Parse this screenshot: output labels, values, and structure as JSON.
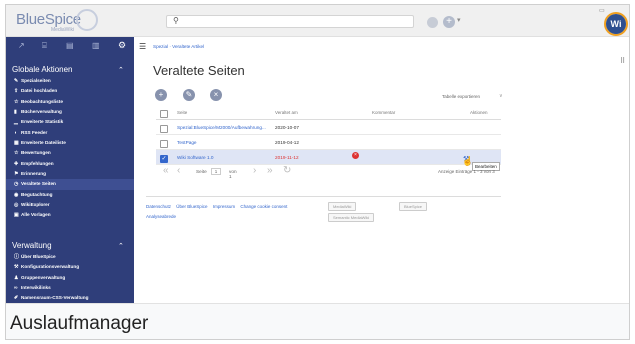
{
  "logo": {
    "text": "BlueSpice",
    "subtitle": "MediaWiki"
  },
  "search": {
    "placeholder": ""
  },
  "user": {
    "initials": "Wi"
  },
  "sidebar": {
    "global_heading": "Globale Aktionen",
    "global_items": [
      {
        "label": "Spezialseiten",
        "icon": "wand-icon"
      },
      {
        "label": "Datei hochladen",
        "icon": "upload-icon"
      },
      {
        "label": "Beobachtungsliste",
        "icon": "star-icon"
      },
      {
        "label": "Bücherverwaltung",
        "icon": "book-icon"
      },
      {
        "label": "Erweiterte Statistik",
        "icon": "chart-icon"
      },
      {
        "label": "RSS Feeder",
        "icon": "rss-icon"
      },
      {
        "label": "Erweiterte Dateiliste",
        "icon": "file-icon"
      },
      {
        "label": "Bewertungen",
        "icon": "star-icon"
      },
      {
        "label": "Empfehlungen",
        "icon": "thumb-icon"
      },
      {
        "label": "Erinnerung",
        "icon": "flag-icon"
      },
      {
        "label": "Veraltete Seiten",
        "icon": "clock-icon"
      },
      {
        "label": "Begutachtung",
        "icon": "eye-icon"
      },
      {
        "label": "WikiExplorer",
        "icon": "compass-icon"
      },
      {
        "label": "Alle Vorlagen",
        "icon": "template-icon"
      }
    ],
    "admin_heading": "Verwaltung",
    "admin_items": [
      {
        "label": "Über BlueSpice",
        "icon": "info-icon"
      },
      {
        "label": "Konfigurationsverwaltung",
        "icon": "wrench-icon"
      },
      {
        "label": "Gruppenverwaltung",
        "icon": "group-icon"
      },
      {
        "label": "Interwikilinks",
        "icon": "link-icon"
      },
      {
        "label": "Namensraum-CSS-Verwaltung",
        "icon": "brush-icon"
      }
    ]
  },
  "breadcrumb": "Spezial · Veraltete Artikel",
  "page_title": "Veraltete Seiten",
  "export_label": "Tabelle exportieren",
  "table": {
    "columns": {
      "page": "Seite",
      "date": "Veraltet am",
      "comment": "Kommentar",
      "actions": "Aktionen"
    },
    "rows": [
      {
        "page": "Spezial:BlueSpice/M2000/Aufbewahrung...",
        "date": "2020-10-07",
        "selected": false
      },
      {
        "page": "TestPage",
        "date": "2019-04-12",
        "selected": false
      },
      {
        "page": "Wiki Software 1.0",
        "date": "2019-11-12",
        "selected": true
      }
    ]
  },
  "tooltip": "Bearbeiten",
  "pager": {
    "page_label": "Seite",
    "page_value": "1",
    "of_label": "von 1",
    "right_text": "Anzeige Einträge 1 - 3 von 3"
  },
  "footer": {
    "links": [
      "Datenschutz",
      "Über BlueSpice",
      "Impressum",
      "Change cookie consent"
    ],
    "sub_link": "Analyseabrede",
    "badge1": "MediaWiki",
    "badge2": "BlueSpice",
    "badge3": "Semantic MediaWiki"
  },
  "caption": "Auslaufmanager"
}
